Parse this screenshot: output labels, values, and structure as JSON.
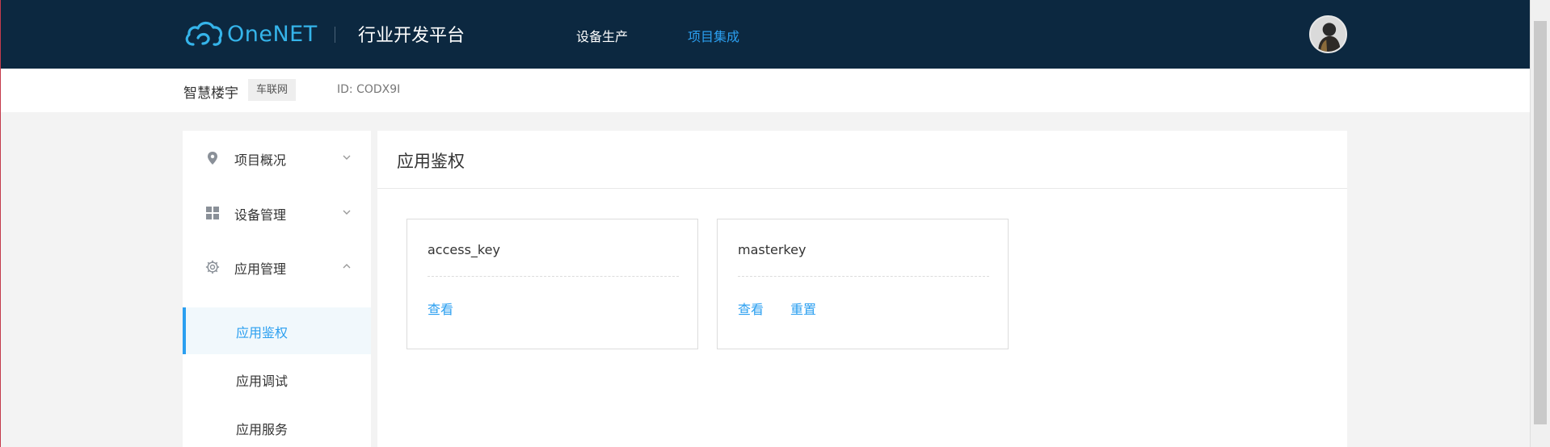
{
  "header": {
    "logo_text": "OneNET",
    "platform_title": "行业开发平台",
    "nav": [
      {
        "label": "设备生产",
        "active": false
      },
      {
        "label": "项目集成",
        "active": true
      }
    ],
    "accent_color": "#2b9ff0",
    "background_color": "#0c2840"
  },
  "project": {
    "name": "智慧楼宇",
    "tag": "车联网",
    "id_text": "ID: CODX9I"
  },
  "sidebar": {
    "groups": [
      {
        "label": "项目概况",
        "icon": "location-pin-icon",
        "expanded": false
      },
      {
        "label": "设备管理",
        "icon": "grid-icon",
        "expanded": false
      },
      {
        "label": "应用管理",
        "icon": "gear-icon",
        "expanded": true
      }
    ],
    "subitems": [
      {
        "label": "应用鉴权",
        "active": true
      },
      {
        "label": "应用调试",
        "active": false
      },
      {
        "label": "应用服务",
        "active": false
      }
    ]
  },
  "main": {
    "title": "应用鉴权",
    "cards": [
      {
        "name": "access_key",
        "actions": [
          "查看"
        ]
      },
      {
        "name": "masterkey",
        "actions": [
          "查看",
          "重置"
        ]
      }
    ]
  }
}
